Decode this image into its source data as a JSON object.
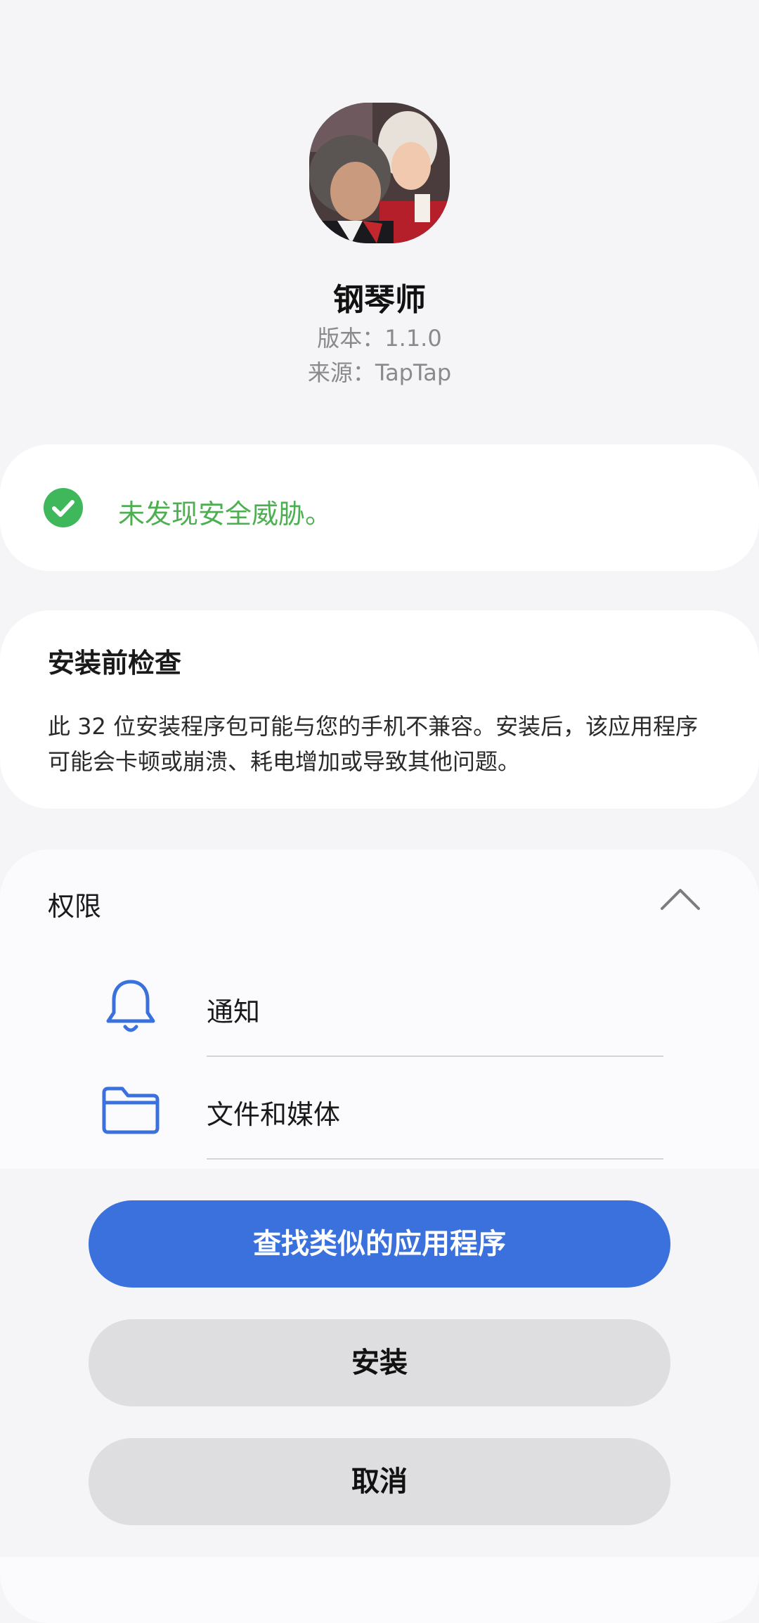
{
  "app": {
    "name": "钢琴师",
    "version": "版本：1.1.0",
    "source": "来源：TapTap",
    "icon": "composer-portrait-app-icon"
  },
  "security": {
    "message": "未发现安全威胁。",
    "icon": "check-circle-icon",
    "color": "#4caf50"
  },
  "precheck": {
    "title": "安装前检查",
    "body": "此 32 位安装程序包可能与您的手机不兼容。安装后，该应用程序可能会卡顿或崩溃、耗电增加或导致其他问题。"
  },
  "permissions": {
    "title": "权限",
    "toggle_icon": "chevron-up-icon",
    "items": [
      {
        "label": "通知",
        "icon": "bell-icon"
      },
      {
        "label": "文件和媒体",
        "icon": "folder-icon"
      }
    ]
  },
  "actions": {
    "find_similar": "查找类似的应用程序",
    "install": "安装",
    "cancel": "取消"
  },
  "colors": {
    "accent": "#3a71dc",
    "background": "#f5f5f7",
    "secondary_button": "#dedee0"
  }
}
